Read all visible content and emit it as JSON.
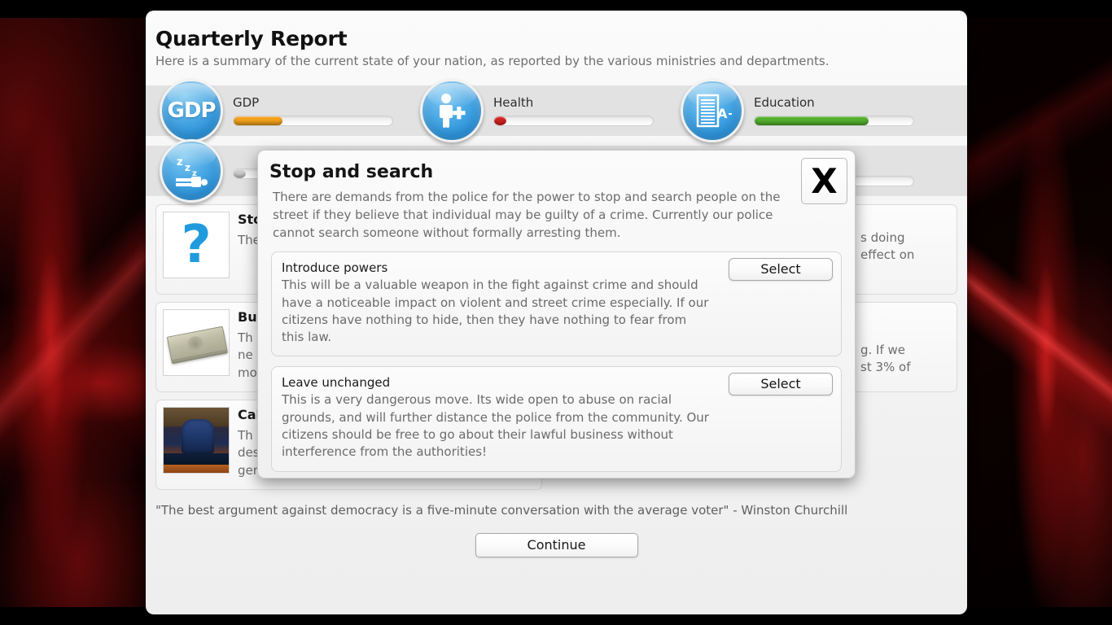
{
  "window": {
    "title": "Quarterly Report",
    "subtitle": "Here is a summary of the current state of your nation, as reported by the various ministries and departments."
  },
  "stats": {
    "row1": [
      {
        "icon": "gdp-icon",
        "icon_text": "GDP",
        "label": "GDP",
        "value_pct": 31,
        "color": "#f2a01b"
      },
      {
        "icon": "health-icon",
        "icon_text": "",
        "label": "Health",
        "value_pct": 4,
        "color": "#d42121"
      },
      {
        "icon": "education-icon",
        "icon_text": "A+",
        "label": "Education",
        "value_pct": 72,
        "color": "#54af2e"
      }
    ],
    "row2": [
      {
        "icon": "unemployment-icon",
        "icon_text": "Zzz",
        "label": "",
        "value_pct": 0,
        "color": "#cccccc"
      }
    ]
  },
  "events": [
    {
      "thumb": "question-mark-image",
      "title": "Sto",
      "text_left": "The\nreq",
      "text_right": "s doing\neffect on"
    },
    {
      "thumb": "money-stack-image",
      "title": "Bu",
      "text_left": "Th\nne\nmo",
      "text_right": "g. If we\nst 3% of"
    },
    {
      "thumb": "cabinet-chair-image",
      "title": "Cab",
      "text_left": "Th",
      "text_visible": "described as 'loyal'.Their effectiveness is\ngenerally considered to be 'passable'."
    }
  ],
  "footer": {
    "quote": "\"The best argument against democracy is a five-minute conversation with the average voter\" - Winston Churchill",
    "continue_label": "Continue"
  },
  "modal": {
    "title": "Stop and search",
    "close_label": "X",
    "description": "There are demands from the police for the power to stop and search people on the street if they believe that individual may be guilty of a crime. Currently our police cannot search someone without formally arresting them.",
    "options": [
      {
        "title": "Introduce powers",
        "description": "This will be a valuable weapon in the fight against crime and should have a noticeable impact on violent and street crime especially. If our citizens have nothing to hide, then they have nothing to fear from this law.",
        "select_label": "Select"
      },
      {
        "title": "Leave unchanged",
        "description": "This is a very dangerous move. Its wide open to abuse on racial grounds, and will further distance the police from the community. Our citizens should be free to go about their lawful business without interference from the authorities!",
        "select_label": "Select"
      }
    ]
  },
  "colors": {
    "accent_blue": "#2a91d8",
    "gdp_orange": "#f2a01b",
    "health_red": "#d42121",
    "education_green": "#54af2e",
    "background_red": "#8d0f0f"
  }
}
